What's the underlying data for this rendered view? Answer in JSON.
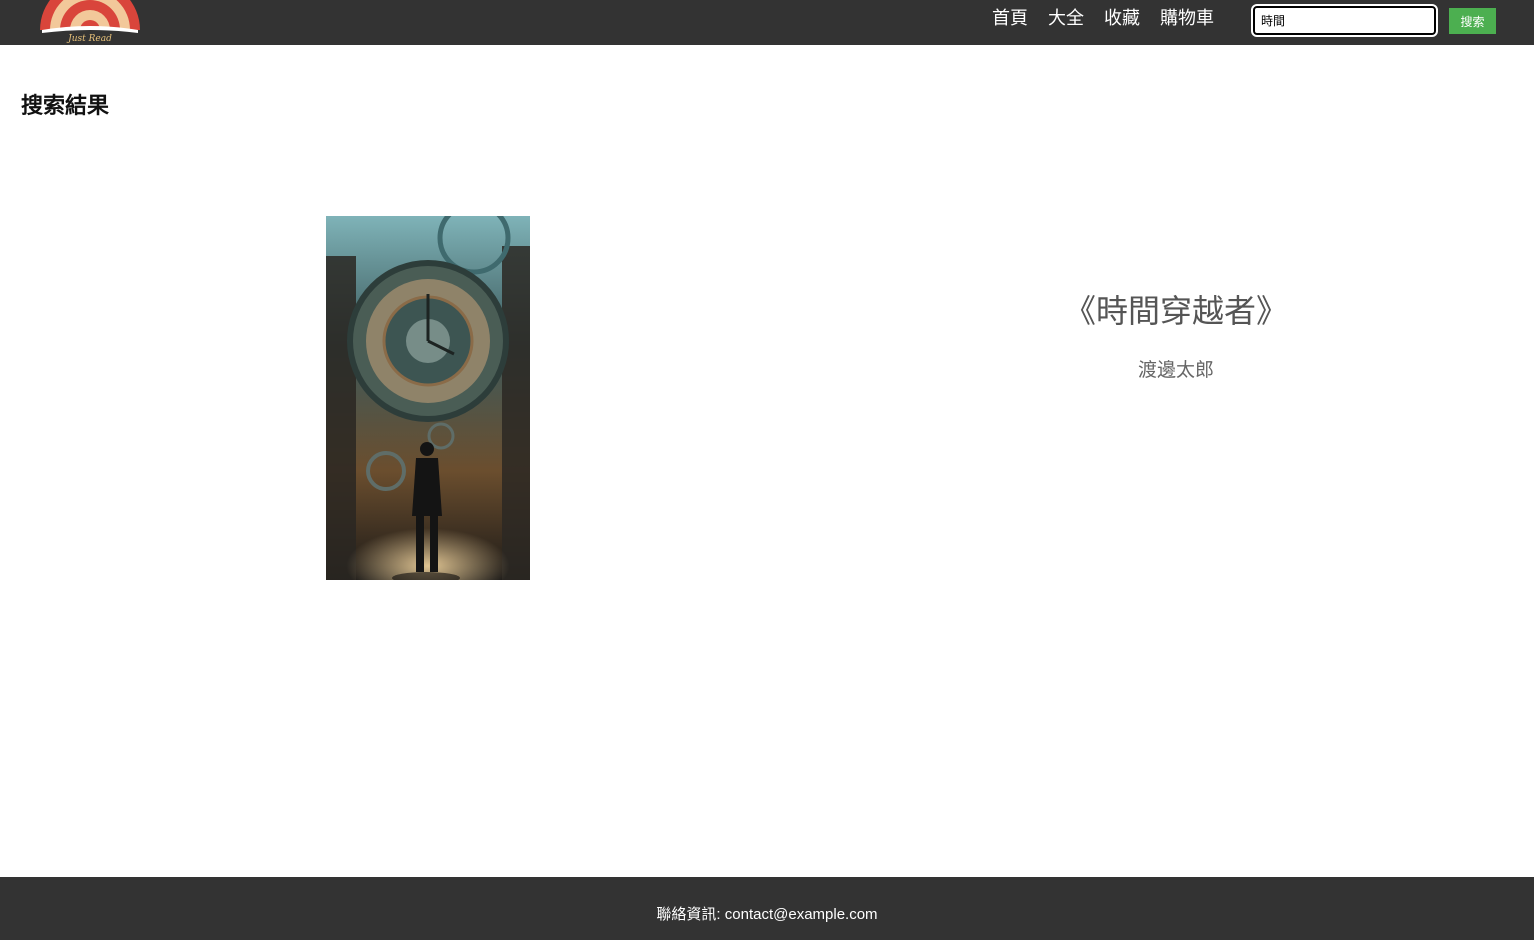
{
  "header": {
    "logo_text": "Just Read",
    "nav": [
      {
        "label": "首頁"
      },
      {
        "label": "大全"
      },
      {
        "label": "收藏"
      },
      {
        "label": "購物車"
      }
    ],
    "search": {
      "value": "時間",
      "button_label": "搜索"
    }
  },
  "main": {
    "title": "搜索結果",
    "results": [
      {
        "title": "《時間穿越者》",
        "author": "渡邊太郎",
        "cover_icon": "clock-traveler-cover"
      }
    ]
  },
  "footer": {
    "contact": "聯絡資訊: contact@example.com"
  },
  "colors": {
    "bar": "#333333",
    "accent": "#4caf50"
  }
}
